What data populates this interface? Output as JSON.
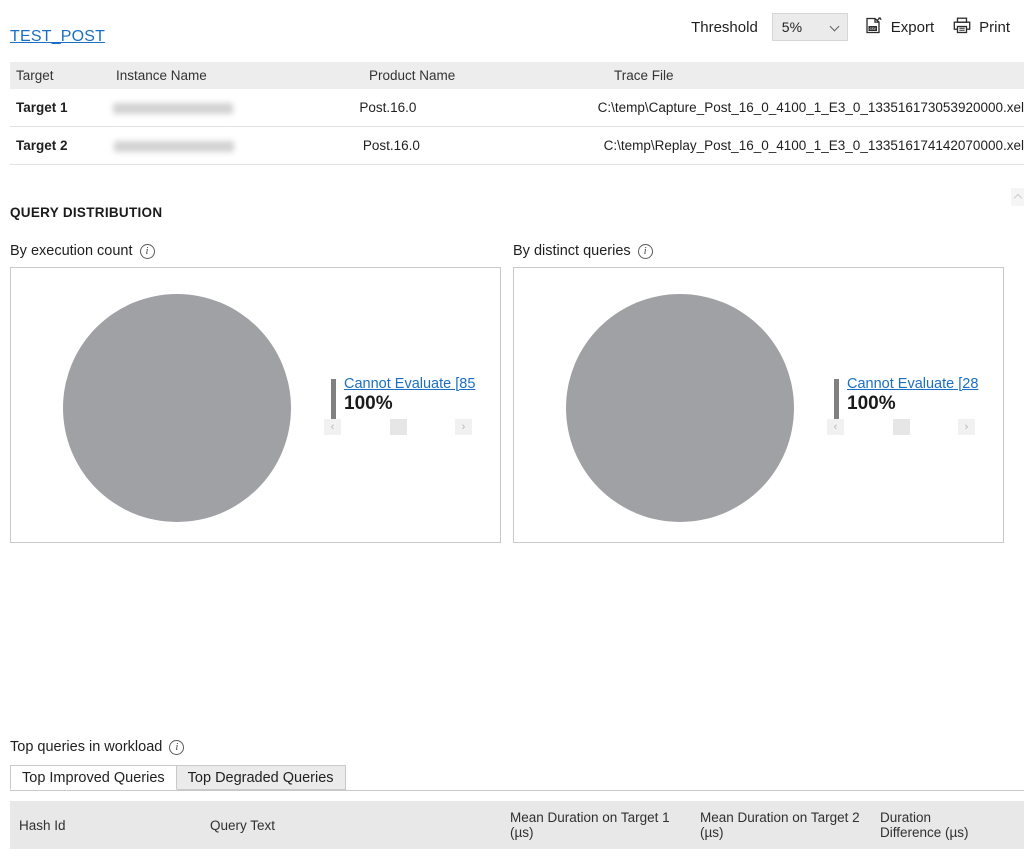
{
  "header": {
    "document_link": "TEST_POST",
    "threshold_label": "Threshold",
    "threshold_value": "5%",
    "export_label": "Export",
    "print_label": "Print",
    "export_icon": "csv-export-icon",
    "print_icon": "printer-icon"
  },
  "targets_table": {
    "columns": [
      "Target",
      "Instance Name",
      "Product Name",
      "Trace File"
    ],
    "rows": [
      {
        "target": "Target 1",
        "instance_name": "",
        "product_name": "Post.16.0",
        "trace_file": "C:\\temp\\Capture_Post_16_0_4100_1_E3_0_133516173053920000.xel"
      },
      {
        "target": "Target 2",
        "instance_name": "",
        "product_name": "Post.16.0",
        "trace_file": "C:\\temp\\Replay_Post_16_0_4100_1_E3_0_133516174142070000.xel"
      }
    ]
  },
  "query_distribution": {
    "section_title": "QUERY DISTRIBUTION",
    "charts": [
      {
        "label": "By execution count",
        "info_icon": "info-icon",
        "legend_link": "Cannot Evaluate [85",
        "legend_percent": "100%",
        "pager_prev": "‹",
        "pager_next": "›"
      },
      {
        "label": "By distinct queries",
        "info_icon": "info-icon",
        "legend_link": "Cannot Evaluate [28",
        "legend_percent": "100%",
        "pager_prev": "‹",
        "pager_next": "›"
      }
    ]
  },
  "chart_data": [
    {
      "type": "pie",
      "title": "By execution count",
      "categories": [
        "Cannot Evaluate [85"
      ],
      "values": [
        100
      ],
      "value_labels": [
        "100%"
      ],
      "colors": [
        "#9fa1a5"
      ],
      "legend_position": "right",
      "grid": false
    },
    {
      "type": "pie",
      "title": "By distinct queries",
      "categories": [
        "Cannot Evaluate [28"
      ],
      "values": [
        100
      ],
      "value_labels": [
        "100%"
      ],
      "colors": [
        "#9fa1a5"
      ],
      "legend_position": "right",
      "grid": false
    }
  ],
  "bottom": {
    "label": "Top queries in workload",
    "info_icon": "info-icon",
    "tabs": [
      {
        "label": "Top Improved Queries",
        "active": true
      },
      {
        "label": "Top Degraded Queries",
        "active": false
      }
    ],
    "table_columns": {
      "hash_id": "Hash Id",
      "query_text": "Query Text",
      "mean_target1_line1": "Mean Duration on Target 1",
      "mean_target1_line2": "(µs)",
      "mean_target2_line1": "Mean Duration on Target 2",
      "mean_target2_line2": "(µs)",
      "duration_diff_line1": "Duration",
      "duration_diff_line2": "Difference (µs)"
    }
  },
  "colors": {
    "link": "#1a6fc4",
    "pie_slice": "#9fa1a5",
    "header_row": "#ededed",
    "table_header": "#e8e8e8"
  }
}
